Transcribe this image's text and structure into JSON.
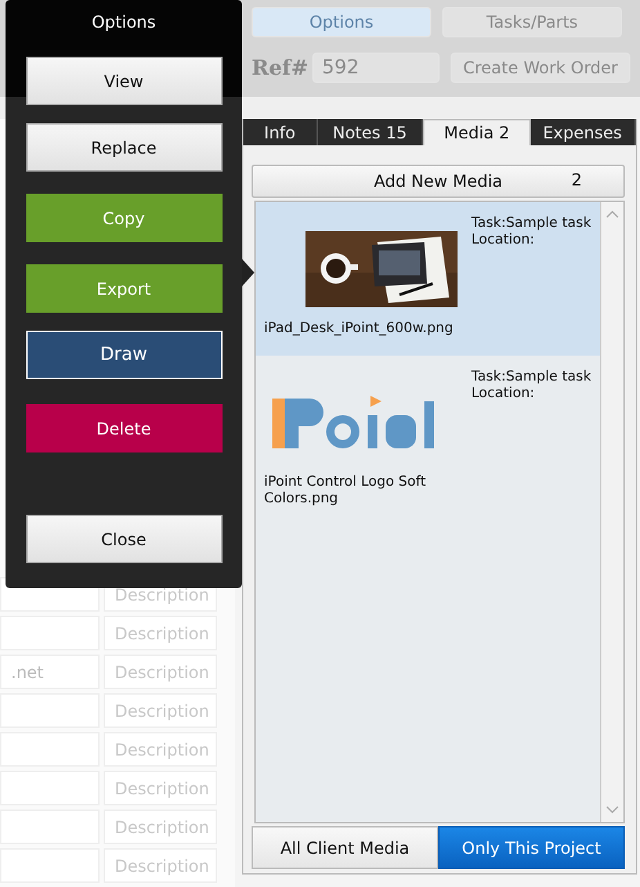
{
  "header": {
    "buttons": [
      {
        "label": "Options",
        "selected": true
      },
      {
        "label": "Tasks/Parts",
        "selected": false
      }
    ],
    "ref_label": "Ref#",
    "ref_value": "592",
    "create_button": "Create Work Order"
  },
  "background_form": {
    "rows": [
      {
        "placeholder": "Description"
      },
      {
        "placeholder": "Description"
      },
      {
        "value": ".net",
        "placeholder": "Description"
      },
      {
        "placeholder": "Description"
      },
      {
        "placeholder": "Description"
      },
      {
        "placeholder": "Description"
      },
      {
        "placeholder": "Description"
      },
      {
        "placeholder": "Description"
      }
    ]
  },
  "popup": {
    "title": "Options",
    "buttons": [
      {
        "label": "View",
        "kind": "plain"
      },
      {
        "label": "Replace",
        "kind": "plain"
      },
      {
        "label": "Copy",
        "kind": "success"
      },
      {
        "label": "Export",
        "kind": "success"
      },
      {
        "label": "Draw",
        "kind": "primary"
      },
      {
        "label": "Delete",
        "kind": "danger"
      },
      {
        "label": "Close",
        "kind": "plain"
      }
    ]
  },
  "tabs": [
    {
      "label": "Info",
      "selected": false
    },
    {
      "label": "Notes 15",
      "selected": false
    },
    {
      "label": "Media 2",
      "selected": true
    },
    {
      "label": "Expenses",
      "selected": false
    }
  ],
  "media": {
    "add_button": "Add New Media",
    "count": "2",
    "items": [
      {
        "filename": "iPad_Desk_iPoint_600w.png",
        "task": "Task:Sample task",
        "location": "Location:",
        "selected": true
      },
      {
        "filename": "iPoint Control Logo Soft Colors.png",
        "task": "Task:Sample task",
        "location": "Location:",
        "selected": false
      }
    ]
  },
  "filters": [
    {
      "label": "All Client Media",
      "selected": false
    },
    {
      "label": "Only This Project",
      "selected": true
    }
  ]
}
